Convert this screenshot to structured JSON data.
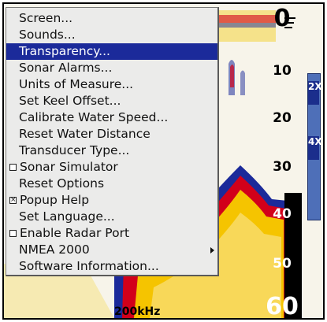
{
  "menu": {
    "items": [
      {
        "label": "Screen..."
      },
      {
        "label": "Sounds..."
      },
      {
        "label": "Transparency...",
        "selected": true
      },
      {
        "label": "Sonar Alarms..."
      },
      {
        "label": "Units of Measure..."
      },
      {
        "label": "Set Keel Offset..."
      },
      {
        "label": "Calibrate Water Speed..."
      },
      {
        "label": "Reset Water Distance"
      },
      {
        "label": "Transducer Type..."
      },
      {
        "label": "Sonar Simulator",
        "checkbox": true,
        "checked": false
      },
      {
        "label": "Reset Options"
      },
      {
        "label": "Popup Help",
        "checkbox": true,
        "checked": true
      },
      {
        "label": "Set Language..."
      },
      {
        "label": "Enable Radar Port",
        "checkbox": true,
        "checked": false
      },
      {
        "label": "NMEA 2000",
        "submenu": true
      },
      {
        "label": "Software Information..."
      }
    ]
  },
  "depth_scale": {
    "labels": [
      "0",
      "10",
      "20",
      "30",
      "40",
      "50",
      "60"
    ]
  },
  "frequency": "200kHz",
  "zoom_bar": {
    "labels": [
      "2X",
      "4X"
    ]
  },
  "colors": {
    "menu_highlight": "#1b2a9a",
    "menu_background": "#ebebea",
    "zoom_bar": "#4e6fb8",
    "sonar_strong": "#d2001a",
    "sonar_mid": "#f5c400",
    "sonar_weak": "#1b2a9a"
  }
}
